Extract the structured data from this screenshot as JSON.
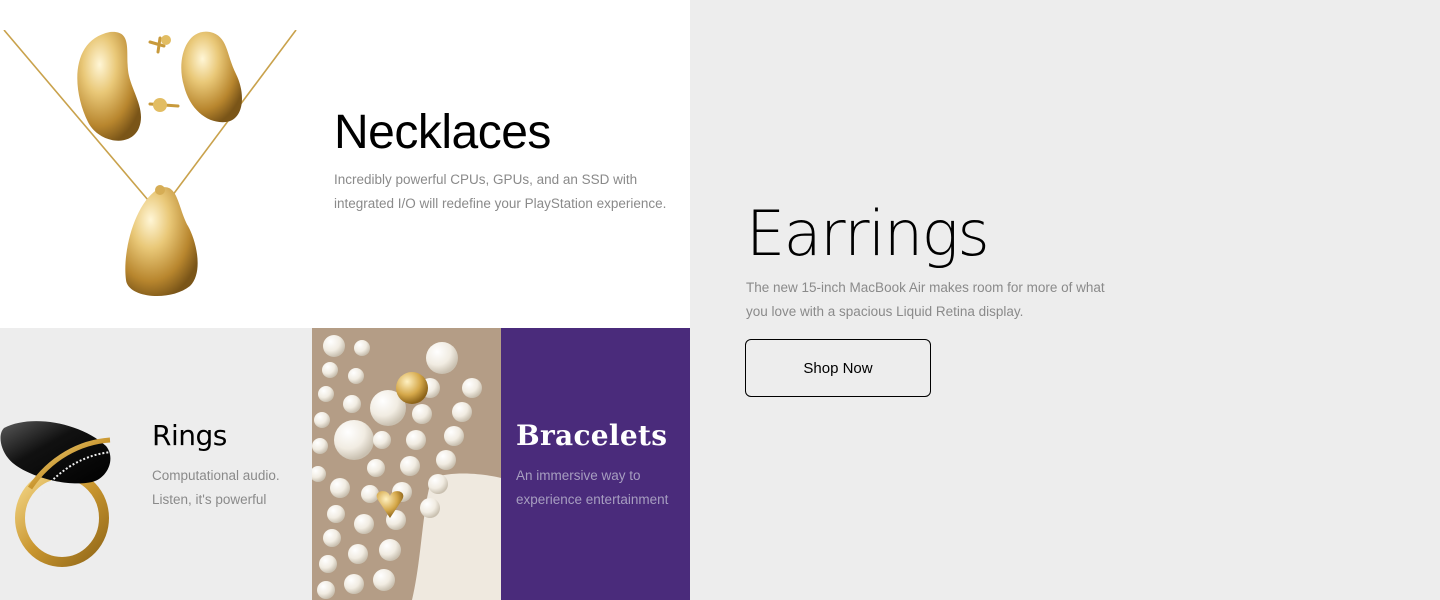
{
  "necklaces": {
    "title": "Necklaces",
    "description": "Incredibly powerful CPUs, GPUs, and an SSD with integrated I/O will redefine your PlayStation experience."
  },
  "earrings": {
    "title": "Earrings",
    "description": "The new 15-inch MacBook Air makes room for more of what you love with a spacious Liquid Retina display.",
    "button_label": "Shop Now"
  },
  "rings": {
    "title": "Rings",
    "description": "Computational audio. Listen, it's powerful"
  },
  "bracelets": {
    "title": "Bracelets",
    "description": "An immersive way to experience entertainment"
  },
  "colors": {
    "white_tile": "#ffffff",
    "grey_tile": "#ededed",
    "purple_tile": "#4a2b7b",
    "muted_text": "#8a8a8a",
    "gold": "#d9b35a"
  }
}
